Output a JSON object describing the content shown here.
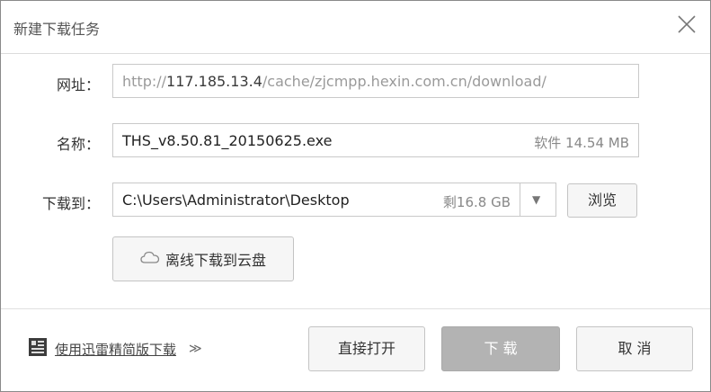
{
  "dialog": {
    "title": "新建下载任务"
  },
  "url_row": {
    "label": "网址：",
    "prefix": "http://",
    "host": "117.185.13.4",
    "path": "/cache/zjcmpp.hexin.com.cn/download/"
  },
  "name_row": {
    "label": "名称：",
    "filename": "THS_v8.50.81_20150625.exe",
    "file_info": "软件 14.54 MB"
  },
  "dest_row": {
    "label": "下载到：",
    "path": "C:\\Users\\Administrator\\Desktop",
    "free_space": "剩16.8 GB",
    "dropdown_glyph": "▼",
    "browse_label": "浏览"
  },
  "cloud_button": {
    "label": "离线下载到云盘",
    "icon": "cloud-icon"
  },
  "footer": {
    "lite_link": "使用迅雷精简版下载",
    "lite_icon": "thunder-lite-icon",
    "expand_glyph": "≫",
    "direct_open_label": "直接打开",
    "download_label": "下 载",
    "cancel_label": "取 消"
  }
}
